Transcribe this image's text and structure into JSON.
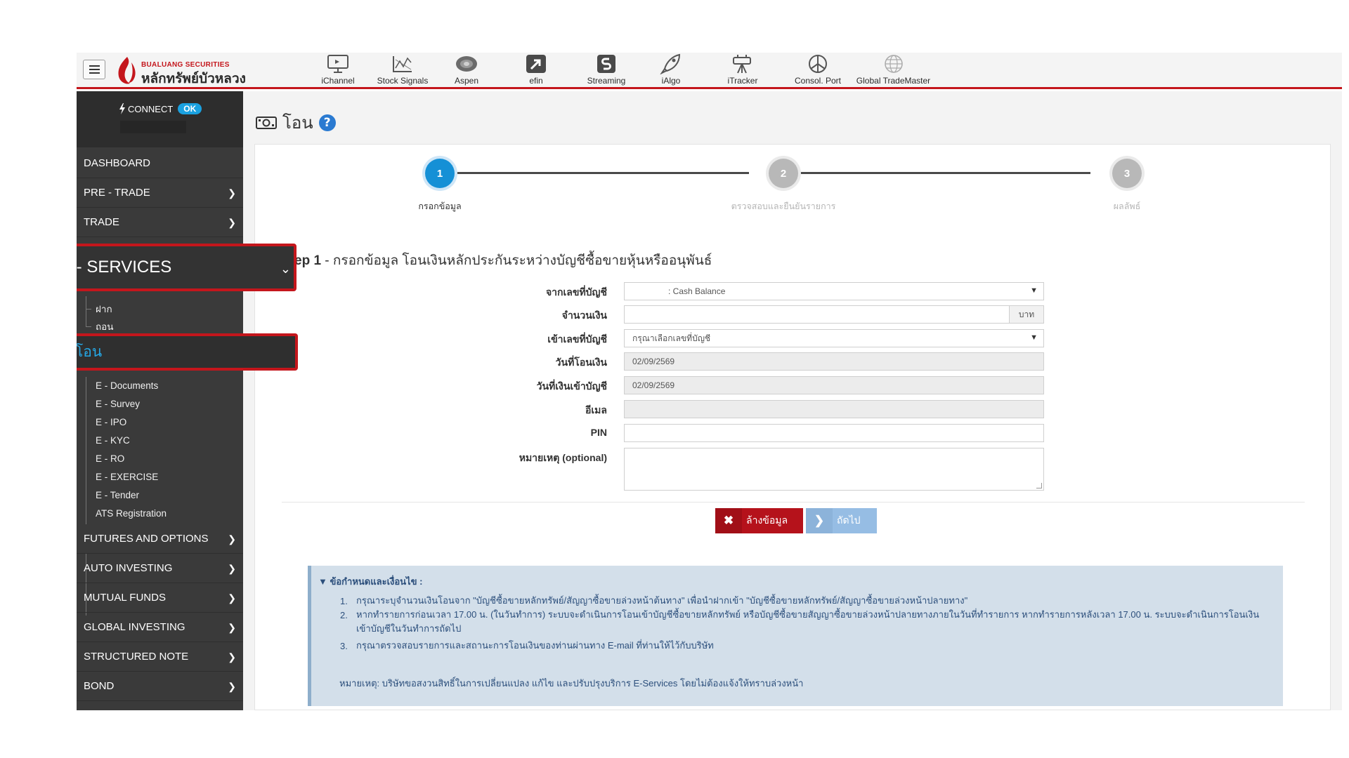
{
  "header": {
    "logo_en": "BUALUANG SECURITIES",
    "logo_th": "หลักทรัพย์บัวหลวง",
    "tools": [
      {
        "label": "iChannel",
        "icon": "monitor-icon"
      },
      {
        "label": "Stock Signals",
        "icon": "chart-signal-icon"
      },
      {
        "label": "Aspen",
        "icon": "aspen-logo-icon"
      },
      {
        "label": "efin",
        "icon": "efin-logo-icon"
      },
      {
        "label": "Streaming",
        "icon": "streaming-logo-icon"
      },
      {
        "label": "iAlgo",
        "icon": "rocket-icon"
      },
      {
        "label": "iTracker",
        "icon": "telescope-icon"
      },
      {
        "label": "Consol. Port",
        "icon": "pie-chart-icon"
      },
      {
        "label": "Global TradeMaster",
        "icon": "globe-icon"
      }
    ]
  },
  "sidebar": {
    "connect_label": "CONNECT",
    "connect_status": "OK",
    "items": [
      {
        "label": "DASHBOARD"
      },
      {
        "label": "PRE - TRADE"
      },
      {
        "label": "TRADE"
      }
    ],
    "eservices_label": "E - SERVICES",
    "eservices_sub": [
      {
        "label": "ฝาก"
      },
      {
        "label": "ถอน"
      }
    ],
    "active_sub": "โอน",
    "eservices_sub2": [
      {
        "label": "E - Documents"
      },
      {
        "label": "E - Survey"
      },
      {
        "label": "E - IPO"
      },
      {
        "label": "E - KYC"
      },
      {
        "label": "E - RO"
      },
      {
        "label": "E - EXERCISE"
      },
      {
        "label": "E - Tender"
      },
      {
        "label": "ATS Registration"
      }
    ],
    "bottom_items": [
      {
        "label": "FUTURES AND OPTIONS"
      },
      {
        "label": "AUTO INVESTING"
      },
      {
        "label": "MUTUAL FUNDS"
      },
      {
        "label": "GLOBAL INVESTING"
      },
      {
        "label": "STRUCTURED NOTE"
      },
      {
        "label": "BOND"
      }
    ]
  },
  "page": {
    "title": "โอน",
    "steps": [
      {
        "num": "1",
        "label": "กรอกข้อมูล"
      },
      {
        "num": "2",
        "label": "ตรวจสอบและยืนยันรายการ"
      },
      {
        "num": "3",
        "label": "ผลลัพธ์"
      }
    ],
    "heading_bold": "ep 1",
    "heading_rest": " - กรอกข้อมูล โอนเงินหลักประกันระหว่างบัญชีซื้อขายหุ้นหรืออนุพันธ์"
  },
  "form": {
    "from_label": "จากเลขที่บัญชี",
    "from_value": ": Cash Balance",
    "amount_label": "จำนวนเงิน",
    "amount_unit": "บาท",
    "to_label": "เข้าเลขที่บัญชี",
    "to_value": "กรุณาเลือกเลขที่บัญชี",
    "transfer_date_label": "วันที่โอนเงิน",
    "transfer_date_value": "02/09/2569",
    "receive_date_label": "วันที่เงินเข้าบัญชี",
    "receive_date_value": "02/09/2569",
    "email_label": "อีเมล",
    "pin_label": "PIN",
    "note_label": "หมายเหตุ (optional)"
  },
  "buttons": {
    "clear": "ล้างข้อมูล",
    "next": "ถัดไป"
  },
  "terms": {
    "title": "ข้อกำหนดและเงื่อนไข :",
    "items": [
      {
        "num": "1.",
        "text": "กรุณาระบุจำนวนเงินโอนจาก \"บัญชีซื้อขายหลักทรัพย์/สัญญาซื้อขายล่วงหน้าต้นทาง\" เพื่อนำฝากเข้า \"บัญชีซื้อขายหลักทรัพย์/สัญญาซื้อขายล่วงหน้าปลายทาง\""
      },
      {
        "num": "2.",
        "text": "หากทำรายการก่อนเวลา 17.00 น. (ในวันทำการ) ระบบจะดำเนินการโอนเข้าบัญชีซื้อขายหลักทรัพย์ หรือบัญชีซื้อขายสัญญาซื้อขายล่วงหน้าปลายทางภายในวันที่ทำรายการ หากทำรายการหลังเวลา 17.00 น. ระบบจะดำเนินการโอนเงินเข้าบัญชีในวันทำการถัดไป"
      },
      {
        "num": "3.",
        "text": "กรุณาตรวจสอบรายการและสถานะการโอนเงินของท่านผ่านทาง E-mail ที่ท่านให้ไว้กับบริษัท"
      }
    ],
    "footnote": "หมายเหตุ: บริษัทขอสงวนสิทธิ์ในการเปลี่ยนแปลง แก้ไข และปรับปรุงบริการ E-Services โดยไม่ต้องแจ้งให้ทราบล่วงหน้า"
  },
  "colors": {
    "brand_red": "#c4161c",
    "active_blue": "#1590d6",
    "sidebar_bg": "#3a3a3a",
    "terms_bg": "#d3dfea"
  }
}
